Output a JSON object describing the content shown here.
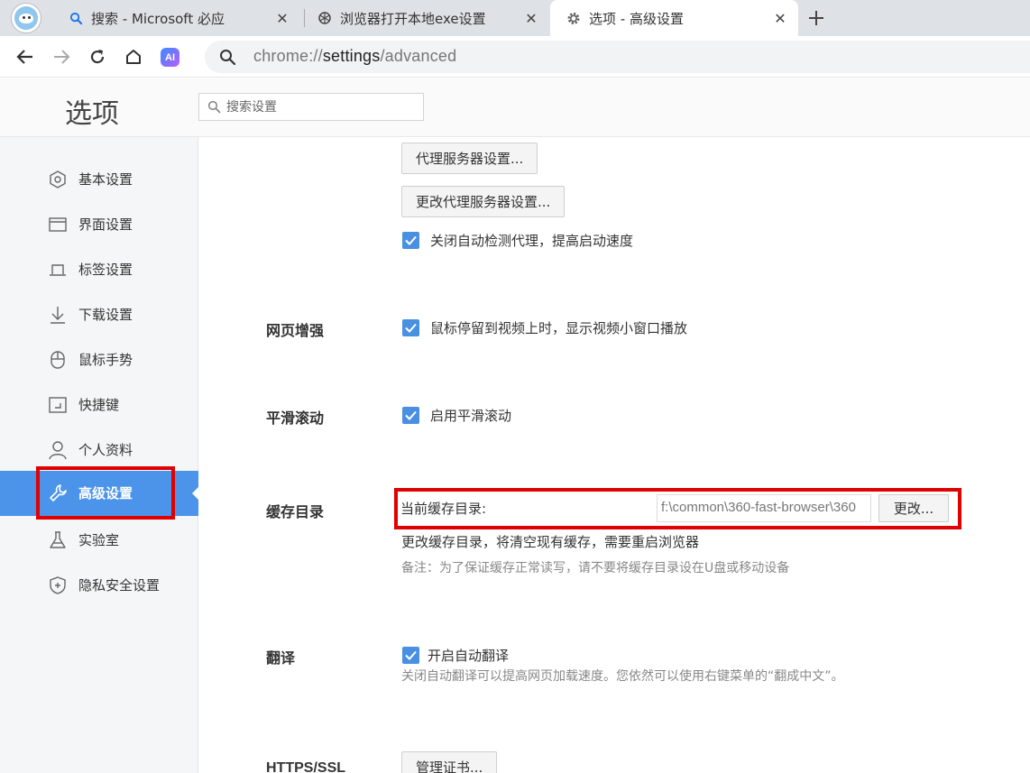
{
  "tabs": [
    {
      "title": "搜索 - Microsoft 必应",
      "icon": "search-icon",
      "active": false
    },
    {
      "title": "浏览器打开本地exe设置",
      "icon": "chatgpt-icon",
      "active": false
    },
    {
      "title": "选项 - 高级设置",
      "icon": "gear-icon",
      "active": true
    }
  ],
  "toolbar": {
    "ai_label": "AI",
    "url_scheme": "chrome://",
    "url_host": "settings",
    "url_path": "/advanced"
  },
  "header": {
    "title": "选项",
    "search_placeholder": "搜索设置"
  },
  "sidebar": {
    "items": [
      {
        "label": "基本设置",
        "icon": "hexagon-icon"
      },
      {
        "label": "界面设置",
        "icon": "window-icon"
      },
      {
        "label": "标签设置",
        "icon": "tab-icon"
      },
      {
        "label": "下载设置",
        "icon": "download-icon"
      },
      {
        "label": "鼠标手势",
        "icon": "mouse-icon"
      },
      {
        "label": "快捷键",
        "icon": "shortcut-icon"
      },
      {
        "label": "个人资料",
        "icon": "person-icon"
      },
      {
        "label": "高级设置",
        "icon": "wrench-icon",
        "active": true
      },
      {
        "label": "实验室",
        "icon": "flask-icon"
      },
      {
        "label": "隐私安全设置",
        "icon": "shield-plus-icon"
      }
    ]
  },
  "main": {
    "proxy": {
      "settings_button": "代理服务器设置...",
      "change_button": "更改代理服务器设置...",
      "auto_detect_label": "关闭自动检测代理，提高启动速度"
    },
    "web_enhance": {
      "title": "网页增强",
      "video_label": "鼠标停留到视频上时，显示视频小窗口播放"
    },
    "smooth_scroll": {
      "title": "平滑滚动",
      "label": "启用平滑滚动"
    },
    "cache": {
      "title": "缓存目录",
      "current_label": "当前缓存目录:",
      "path": "f:\\common\\360-fast-browser\\360",
      "change_button": "更改...",
      "hint": "更改缓存目录，将清空现有缓存，需要重启浏览器",
      "note": "备注：为了保证缓存正常读写，请不要将缓存目录设在U盘或移动设备"
    },
    "translate": {
      "title": "翻译",
      "label": "开启自动翻译",
      "desc": "关闭自动翻译可以提高网页加载速度。您依然可以使用右键菜单的“翻成中文”。"
    },
    "https": {
      "title": "HTTPS/SSL",
      "cert_button": "管理证书..."
    }
  },
  "colors": {
    "accent": "#4c94ea",
    "highlight_box": "#e00000",
    "checkbox": "#4a90e2"
  }
}
